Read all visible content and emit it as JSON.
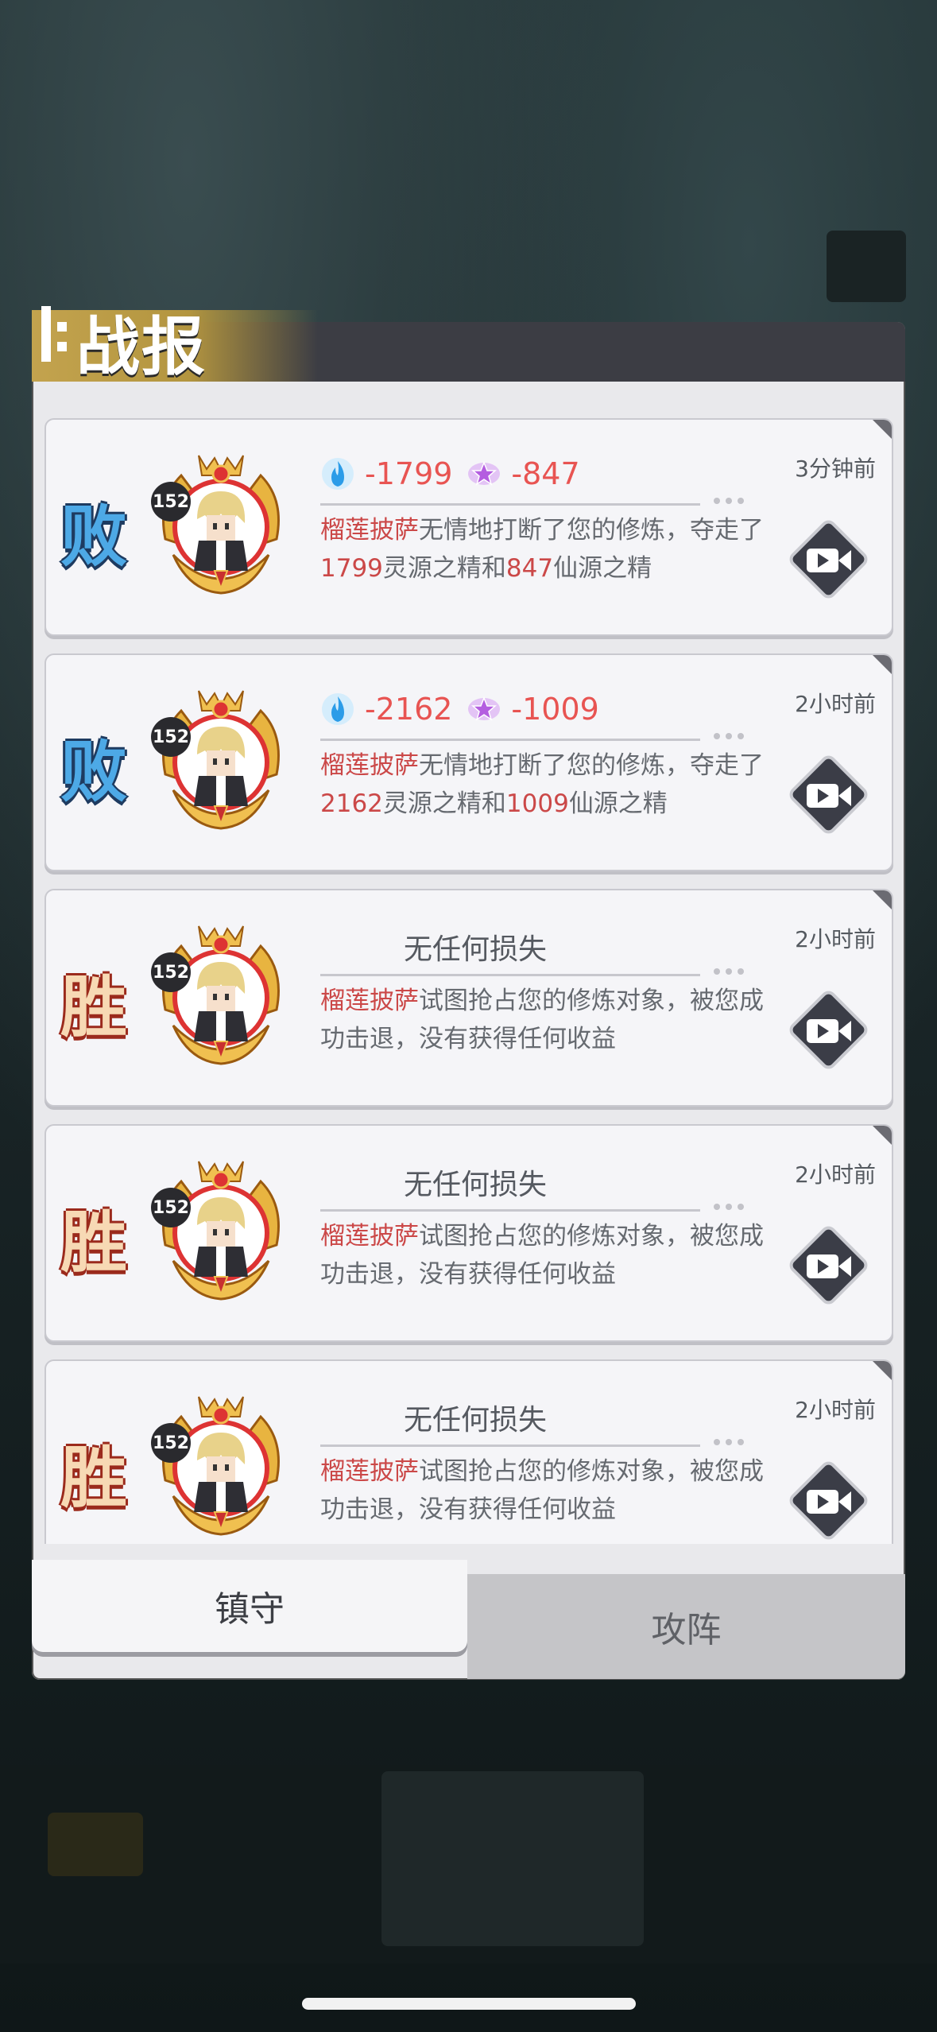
{
  "dialog": {
    "title": "战报"
  },
  "reports": [
    {
      "result": "败",
      "level": "152",
      "type": "loss",
      "spirit_loss": "-1799",
      "immortal_loss": "-847",
      "name": "榴莲披萨",
      "text_a": "无情地打断了您的修炼，夺走了",
      "num_a": "1799",
      "text_b": "灵源之精和",
      "num_b": "847",
      "text_c": "仙源之精",
      "time": "3分钟前"
    },
    {
      "result": "败",
      "level": "152",
      "type": "loss",
      "spirit_loss": "-2162",
      "immortal_loss": "-1009",
      "name": "榴莲披萨",
      "text_a": "无情地打断了您的修炼，夺走了",
      "num_a": "2162",
      "text_b": "灵源之精和",
      "num_b": "1009",
      "text_c": "仙源之精",
      "time": "2小时前"
    },
    {
      "result": "胜",
      "level": "152",
      "type": "win",
      "no_loss": "无任何损失",
      "name": "榴莲披萨",
      "text_a": "试图抢占您的修炼对象，被您成功击退，没有获得任何收益",
      "time": "2小时前"
    },
    {
      "result": "胜",
      "level": "152",
      "type": "win",
      "no_loss": "无任何损失",
      "name": "榴莲披萨",
      "text_a": "试图抢占您的修炼对象，被您成功击退，没有获得任何收益",
      "time": "2小时前"
    },
    {
      "result": "胜",
      "level": "152",
      "type": "win",
      "no_loss": "无任何损失",
      "name": "榴莲披萨",
      "text_a": "试图抢占您的修炼对象，被您成功击退，没有获得任何收益",
      "time": "2小时前"
    }
  ],
  "tabs": {
    "defend": "镇守",
    "attack": "攻阵"
  },
  "icons": {
    "spirit": "blue-flame-icon",
    "immortal": "purple-star-icon",
    "replay": "video-replay-icon"
  },
  "colors": {
    "lose": "#4da9e6",
    "win": "#f7d9b4",
    "loss_value": "#e85452",
    "highlight": "#cb4848"
  }
}
